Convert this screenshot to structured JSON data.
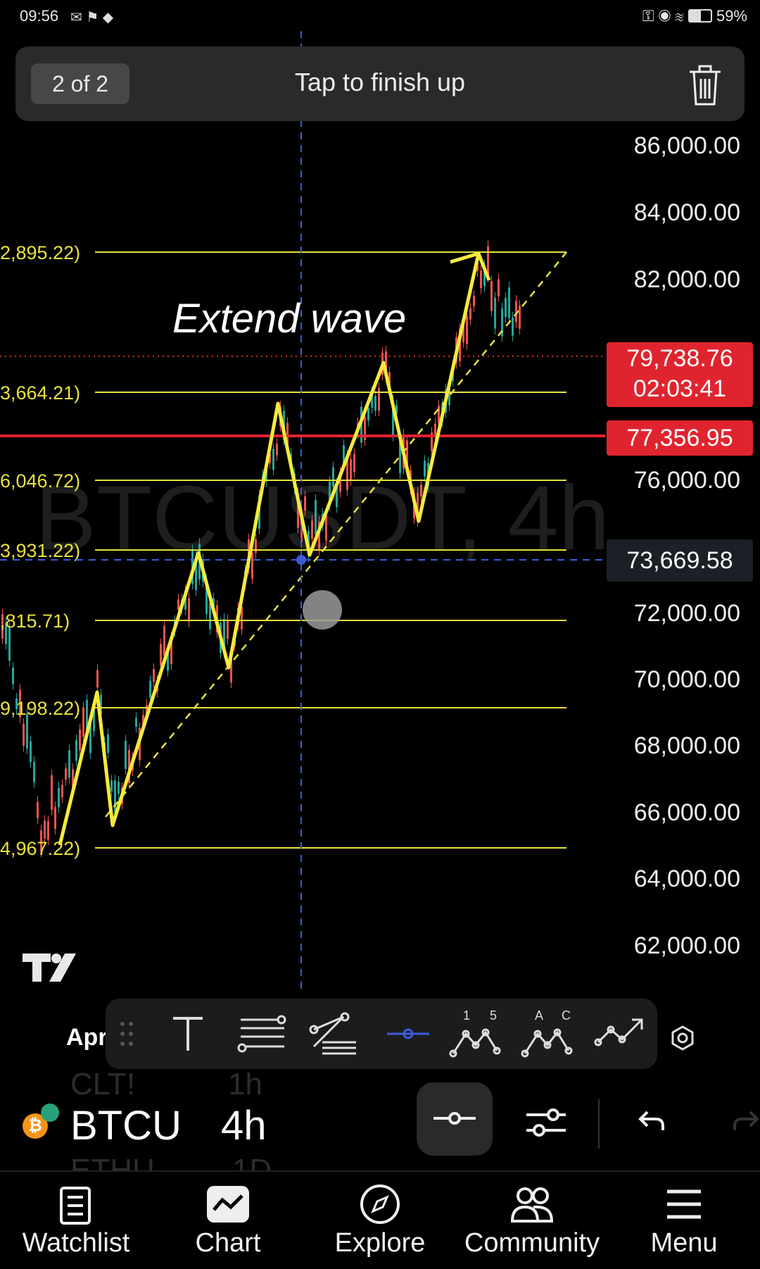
{
  "status": {
    "time": "09:56",
    "battery": "59%"
  },
  "banner": {
    "counter": "2 of 2",
    "message": "Tap to finish up"
  },
  "chart": {
    "annotation": "Extend wave",
    "watermark": "BTCUSDT, 4h",
    "price_axis": [
      "86,000.00",
      "84,000.00",
      "82,000.00",
      "76,000.00",
      "72,000.00",
      "70,000.00",
      "68,000.00",
      "66,000.00",
      "64,000.00",
      "62,000.00"
    ],
    "fib_labels": [
      "2,895.22)",
      "3,664.21)",
      "6,046.72)",
      "3,931.22)",
      ",815.71)",
      "9,198.22)",
      "4,967.22)"
    ],
    "last_price": "79,738.76",
    "countdown": "02:03:41",
    "alert_price": "77,356.95",
    "crosshair_price": "73,669.58",
    "date_label": "Apr",
    "colors": {
      "fib": "#e8e23a",
      "drawing": "#f5ea3c",
      "alert": "#e0242f",
      "crosshair": "#3b5bdb"
    }
  },
  "toolbar": {
    "wave_left": [
      "1",
      "5"
    ],
    "wave_right": [
      "A",
      "C"
    ]
  },
  "symbol": {
    "name": "BTCUSDT",
    "name_visible": "BTCU",
    "interval": "4h",
    "prev": [
      "CLT!",
      "1h"
    ],
    "next": [
      "ETHU",
      "1D"
    ]
  },
  "tabs": [
    {
      "label": "Watchlist",
      "icon": "watchlist-icon"
    },
    {
      "label": "Chart",
      "icon": "chart-icon"
    },
    {
      "label": "Explore",
      "icon": "compass-icon"
    },
    {
      "label": "Community",
      "icon": "community-icon"
    },
    {
      "label": "Menu",
      "icon": "menu-icon"
    }
  ]
}
